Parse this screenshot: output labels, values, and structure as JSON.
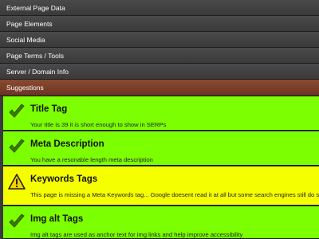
{
  "nav": {
    "items": [
      {
        "label": "External Page Data"
      },
      {
        "label": "Page Elements"
      },
      {
        "label": "Social Media"
      },
      {
        "label": "Page Terms / Tools"
      },
      {
        "label": "Server / Domain Info"
      },
      {
        "label": "Suggestions"
      }
    ],
    "active_index": 5
  },
  "suggestions": [
    {
      "title": "Title Tag",
      "desc": "Your title is 39 it is short enough to show in SERPs",
      "status": "pass",
      "icon": "checkmark-icon"
    },
    {
      "title": "Meta Description",
      "desc": "You have a resonable length meta description",
      "status": "pass",
      "icon": "checkmark-icon"
    },
    {
      "title": "Keywords Tags",
      "desc": "This page is missing a Meta Keywords tag... Google doesent read it at all but some search engines still do so it couldn't hurt...",
      "status": "warning",
      "icon": "warning-icon"
    },
    {
      "title": "Img alt Tags",
      "desc": "Img alt tags are used as anchor text for img links and help improve accessibility",
      "status": "pass",
      "icon": "checkmark-icon"
    }
  ],
  "colors": {
    "pass": "#7cff00",
    "warning": "#f6ff00",
    "active_tab": "#7a3f28"
  }
}
